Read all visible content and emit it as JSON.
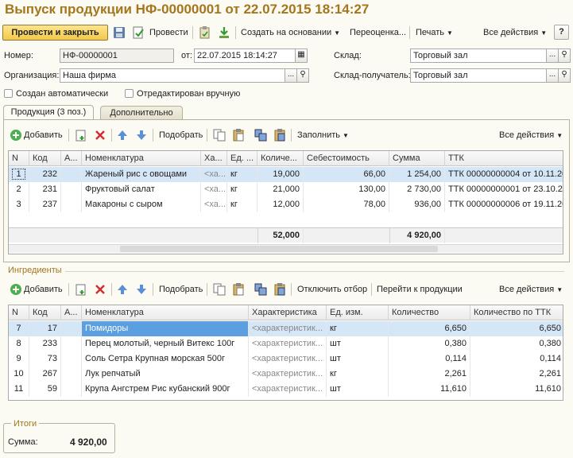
{
  "window": {
    "title": "Выпуск продукции НФ-00000001 от 22.07.2015 18:14:27"
  },
  "toolbar": {
    "post_close": "Провести и закрыть",
    "post": "Провести",
    "create_based": "Создать на основании",
    "revaluation": "Переоценка...",
    "print": "Печать",
    "all_actions": "Все действия",
    "help": "?"
  },
  "header": {
    "number_label": "Номер:",
    "number_value": "НФ-00000001",
    "date_label": "от:",
    "date_value": "22.07.2015 18:14:27",
    "warehouse_label": "Склад:",
    "warehouse_value": "Торговый зал",
    "org_label": "Организация:",
    "org_value": "Наша фирма",
    "recv_label": "Склад-получатель:",
    "recv_value": "Торговый зал",
    "auto_created_label": "Создан автоматически",
    "edited_label": "Отредактирован вручную"
  },
  "tabs": {
    "products": "Продукция (3 поз.)",
    "additional": "Дополнительно"
  },
  "prod_toolbar": {
    "add": "Добавить",
    "pick": "Подобрать",
    "fill": "Заполнить",
    "all_actions": "Все действия"
  },
  "products": {
    "columns": [
      "N",
      "Код",
      "А...",
      "Номенклатура",
      "Ха...",
      "Ед. ...",
      "Количе...",
      "Себестоимость",
      "Сумма",
      "ТТК"
    ],
    "rows": [
      {
        "n": "1",
        "code": "232",
        "a": "",
        "name": "Жареный рис с овощами",
        "char": "<ха...",
        "unit": "кг",
        "qty": "19,000",
        "cost": "66,00",
        "sum": "1 254,00",
        "ttk": "ТТК 00000000004 от 10.11.20"
      },
      {
        "n": "2",
        "code": "231",
        "a": "",
        "name": "Фруктовый салат",
        "char": "<ха...",
        "unit": "кг",
        "qty": "21,000",
        "cost": "130,00",
        "sum": "2 730,00",
        "ttk": "ТТК 00000000001 от 23.10.20"
      },
      {
        "n": "3",
        "code": "237",
        "a": "",
        "name": "Макароны с сыром",
        "char": "<ха...",
        "unit": "кг",
        "qty": "12,000",
        "cost": "78,00",
        "sum": "936,00",
        "ttk": "ТТК 00000000006 от 19.11.20"
      }
    ],
    "total_qty": "52,000",
    "total_sum": "4 920,00"
  },
  "ingredients": {
    "section_title": "Ингредиенты",
    "toolbar": {
      "add": "Добавить",
      "pick": "Подобрать",
      "disable_filter": "Отключить отбор",
      "goto_products": "Перейти к продукции",
      "all_actions": "Все действия"
    },
    "columns": [
      "N",
      "Код",
      "А...",
      "Номенклатура",
      "Характеристика",
      "Ед. изм.",
      "Количество",
      "Количество по ТТК"
    ],
    "rows": [
      {
        "n": "7",
        "code": "17",
        "a": "",
        "name": "Помидоры",
        "char": "<характеристик...",
        "unit": "кг",
        "qty": "6,650",
        "qty_ttk": "6,650"
      },
      {
        "n": "8",
        "code": "233",
        "a": "",
        "name": "Перец молотый, черный Витекс 100г",
        "char": "<характеристик...",
        "unit": "шт",
        "qty": "0,380",
        "qty_ttk": "0,380"
      },
      {
        "n": "9",
        "code": "73",
        "a": "",
        "name": "Соль Сетра Крупная морская 500г",
        "char": "<характеристик...",
        "unit": "шт",
        "qty": "0,114",
        "qty_ttk": "0,114"
      },
      {
        "n": "10",
        "code": "267",
        "a": "",
        "name": "Лук репчатый",
        "char": "<характеристик...",
        "unit": "кг",
        "qty": "2,261",
        "qty_ttk": "2,261"
      },
      {
        "n": "11",
        "code": "59",
        "a": "",
        "name": "Крупа Ангстрем Рис кубанский 900г",
        "char": "<характеристик...",
        "unit": "шт",
        "qty": "11,610",
        "qty_ttk": "11,610"
      }
    ]
  },
  "totals": {
    "title": "Итоги",
    "sum_label": "Сумма:",
    "sum_value": "4 920,00"
  },
  "colors": {
    "title": "#a4761d",
    "selection": "#d5e6f7",
    "primary_button": "#f3c84a"
  }
}
